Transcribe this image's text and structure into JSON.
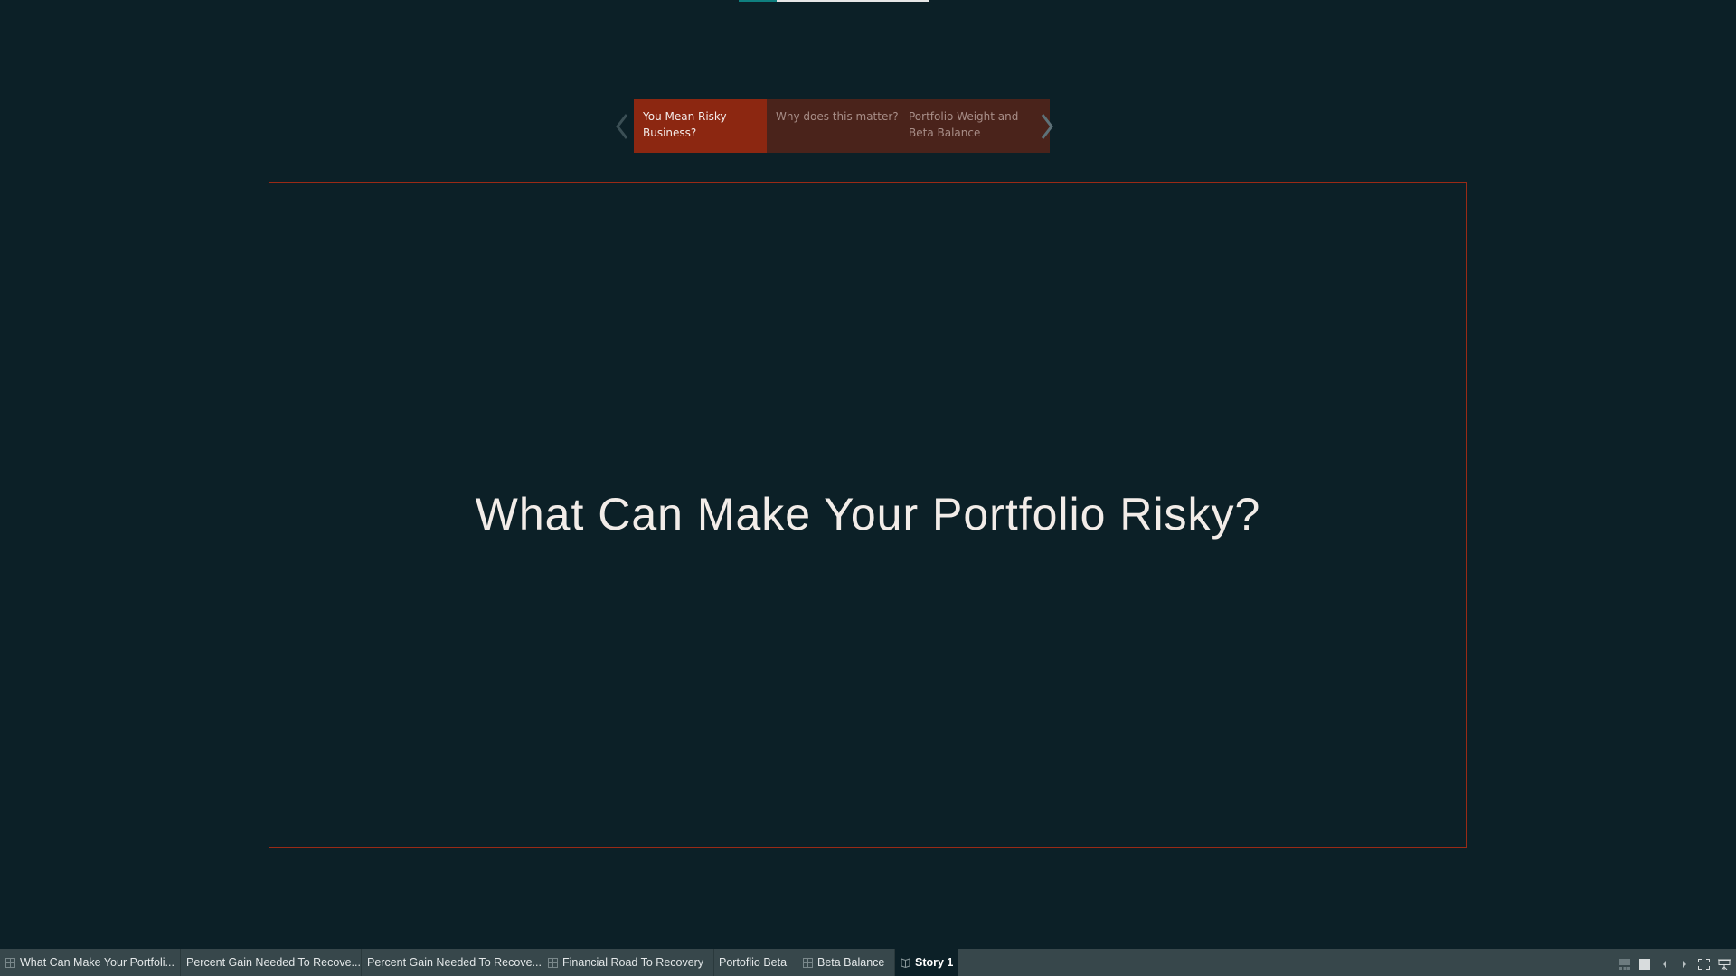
{
  "story": {
    "points": [
      {
        "label": "You Mean Risky Business?",
        "active": true
      },
      {
        "label": "Why does this matter?",
        "active": false
      },
      {
        "label": "Portfolio Weight and Beta Balance",
        "active": false
      }
    ],
    "title": "What Can Make Your Portfolio Risky?"
  },
  "tabs": [
    {
      "label": "What Can Make Your Portfoli...",
      "icon": "dashboard-icon"
    },
    {
      "label": "Percent Gain Needed To Recove...",
      "icon": ""
    },
    {
      "label": "Percent Gain Needed To Recove...",
      "icon": ""
    },
    {
      "label": "Financial Road To Recovery",
      "icon": "dashboard-icon"
    },
    {
      "label": "Portoflio Beta",
      "icon": ""
    },
    {
      "label": "Beta Balance",
      "icon": "dashboard-icon"
    },
    {
      "label": "Story 1",
      "icon": "story-icon"
    }
  ],
  "colors": {
    "background": "#0c2027",
    "active_point": "#8c2711",
    "inactive_point": "#4a231b",
    "frame_border": "#9a2a16",
    "tabbar": "#37474b"
  }
}
